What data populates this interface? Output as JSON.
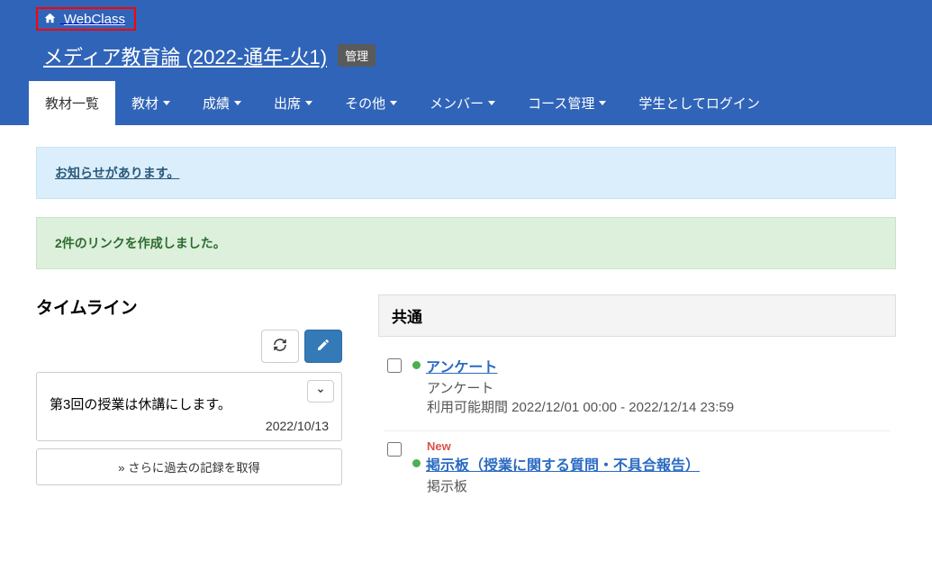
{
  "webclass_label": "WebClass",
  "course_title": "メディア教育論 (2022-通年-火1)",
  "admin_badge": "管理",
  "nav": {
    "materials_list": "教材一覧",
    "materials": "教材",
    "grades": "成績",
    "attendance": "出席",
    "other": "その他",
    "members": "メンバー",
    "course_admin": "コース管理",
    "login_as_student": "学生としてログイン"
  },
  "alert_info": "お知らせがあります。",
  "alert_success": "2件のリンクを作成しました。",
  "timeline": {
    "heading": "タイムライン",
    "item_text": "第3回の授業は休講にします。",
    "item_date": "2022/10/13",
    "history_btn": "» さらに過去の記録を取得"
  },
  "panel": {
    "heading": "共通",
    "items": [
      {
        "new": false,
        "title": "アンケート",
        "type": "アンケート",
        "period": "利用可能期間 2022/12/01 00:00 - 2022/12/14 23:59"
      },
      {
        "new": true,
        "new_label": "New",
        "title": "掲示板（授業に関する質問・不具合報告）",
        "type": "掲示板",
        "period": ""
      }
    ]
  }
}
